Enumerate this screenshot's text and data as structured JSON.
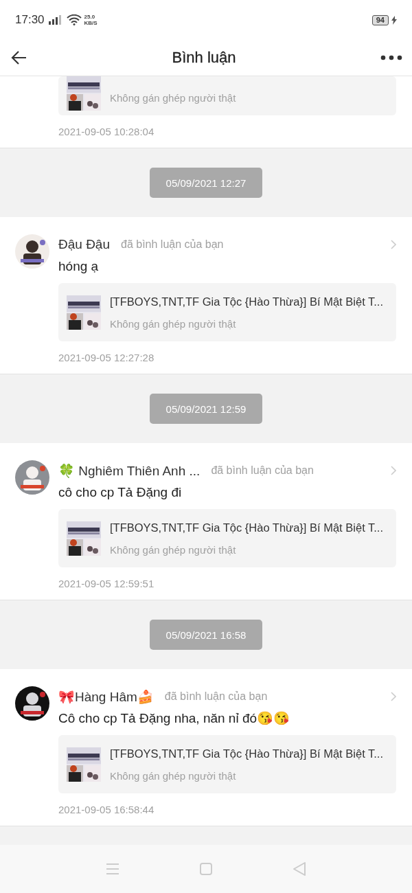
{
  "status_bar": {
    "time": "17:30",
    "net_speed": "25.0",
    "net_unit": "KB/S",
    "battery": "94"
  },
  "header": {
    "title": "Bình luận"
  },
  "items": [
    {
      "kind": "comment_partial",
      "post_subtitle": "Không gán ghép người thật",
      "timestamp": "2021-09-05 10:28:04"
    },
    {
      "kind": "date_divider",
      "label": "05/09/2021 12:27"
    },
    {
      "kind": "comment",
      "name": "Đậu Đậu",
      "action": "đã bình luận của bạn",
      "text": "hóng ạ",
      "post_title": "[TFBOYS,TNT,TF Gia Tộc {Hào Thừa}] Bí Mật Biệt T...",
      "post_subtitle": "Không gán ghép người thật",
      "timestamp": "2021-09-05 12:27:28"
    },
    {
      "kind": "date_divider",
      "label": "05/09/2021 12:59"
    },
    {
      "kind": "comment",
      "name": "🍀 Nghiêm Thiên Anh ...",
      "action": "đã bình luận của bạn",
      "text": "cô cho cp Tả Đặng đi",
      "post_title": "[TFBOYS,TNT,TF Gia Tộc {Hào Thừa}] Bí Mật Biệt T...",
      "post_subtitle": "Không gán ghép người thật",
      "timestamp": "2021-09-05 12:59:51"
    },
    {
      "kind": "date_divider",
      "label": "05/09/2021 16:58"
    },
    {
      "kind": "comment",
      "name": "🎀Hàng Hâm🍰",
      "action": "đã bình luận của bạn",
      "text": "Cô cho cp Tả Đặng nha, năn nỉ đó😘😘",
      "post_title": "[TFBOYS,TNT,TF Gia Tộc {Hào Thừa}] Bí Mật Biệt T...",
      "post_subtitle": "Không gán ghép người thật",
      "timestamp": "2021-09-05 16:58:44"
    }
  ]
}
